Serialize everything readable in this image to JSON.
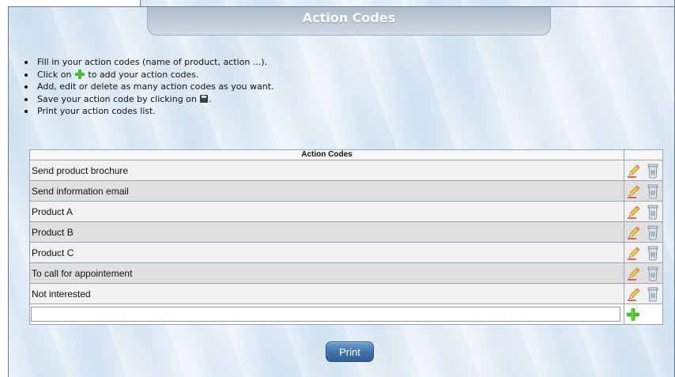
{
  "page": {
    "title": "Action Codes"
  },
  "instructions": [
    {
      "before": "Fill in your action codes (name of product, action ...).",
      "icon": "",
      "after": ""
    },
    {
      "before": "Click on ",
      "icon": "plus-icon",
      "after": " to add your action codes."
    },
    {
      "before": "Add, edit or delete as many action codes as you want.",
      "icon": "",
      "after": ""
    },
    {
      "before": "Save your action code by clicking on ",
      "icon": "disk-icon",
      "after": "."
    },
    {
      "before": "Print your action codes list.",
      "icon": "",
      "after": ""
    }
  ],
  "table": {
    "header": "Action Codes",
    "rows": [
      "Send product brochure",
      "Send information email",
      "Product A",
      "Product B",
      "Product C",
      "To call for appointement",
      "Not interested"
    ],
    "new_value": ""
  },
  "buttons": {
    "print": "Print"
  },
  "colors": {
    "title_bar": "#bcc8d4",
    "print_button": "#3f72aa",
    "add_icon": "#4cbb2f",
    "row_odd": "#f1f1f1",
    "row_even": "#e0e0e0"
  }
}
